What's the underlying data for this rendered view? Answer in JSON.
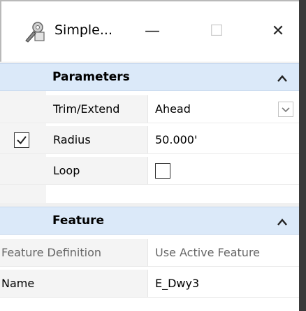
{
  "window": {
    "title": "Simple..."
  },
  "titlebar_buttons": {
    "minimize_glyph": "—",
    "maximize_glyph": "☐",
    "close_glyph": "✕"
  },
  "parameters": {
    "header": "Parameters",
    "trim_extend": {
      "label": "Trim/Extend",
      "value": "Ahead"
    },
    "radius": {
      "label": "Radius",
      "value": "50.000'",
      "locked": true
    },
    "loop": {
      "label": "Loop",
      "checked": false
    }
  },
  "feature": {
    "header": "Feature",
    "feature_definition": {
      "label": "Feature Definition",
      "value": "Use Active Feature"
    },
    "name": {
      "label": "Name",
      "value": "E_Dwy3"
    }
  },
  "colors": {
    "section_header_bg": "#dbe9f9",
    "panel_bg": "#ffffff",
    "gutter_bg": "#f4f4f4"
  }
}
